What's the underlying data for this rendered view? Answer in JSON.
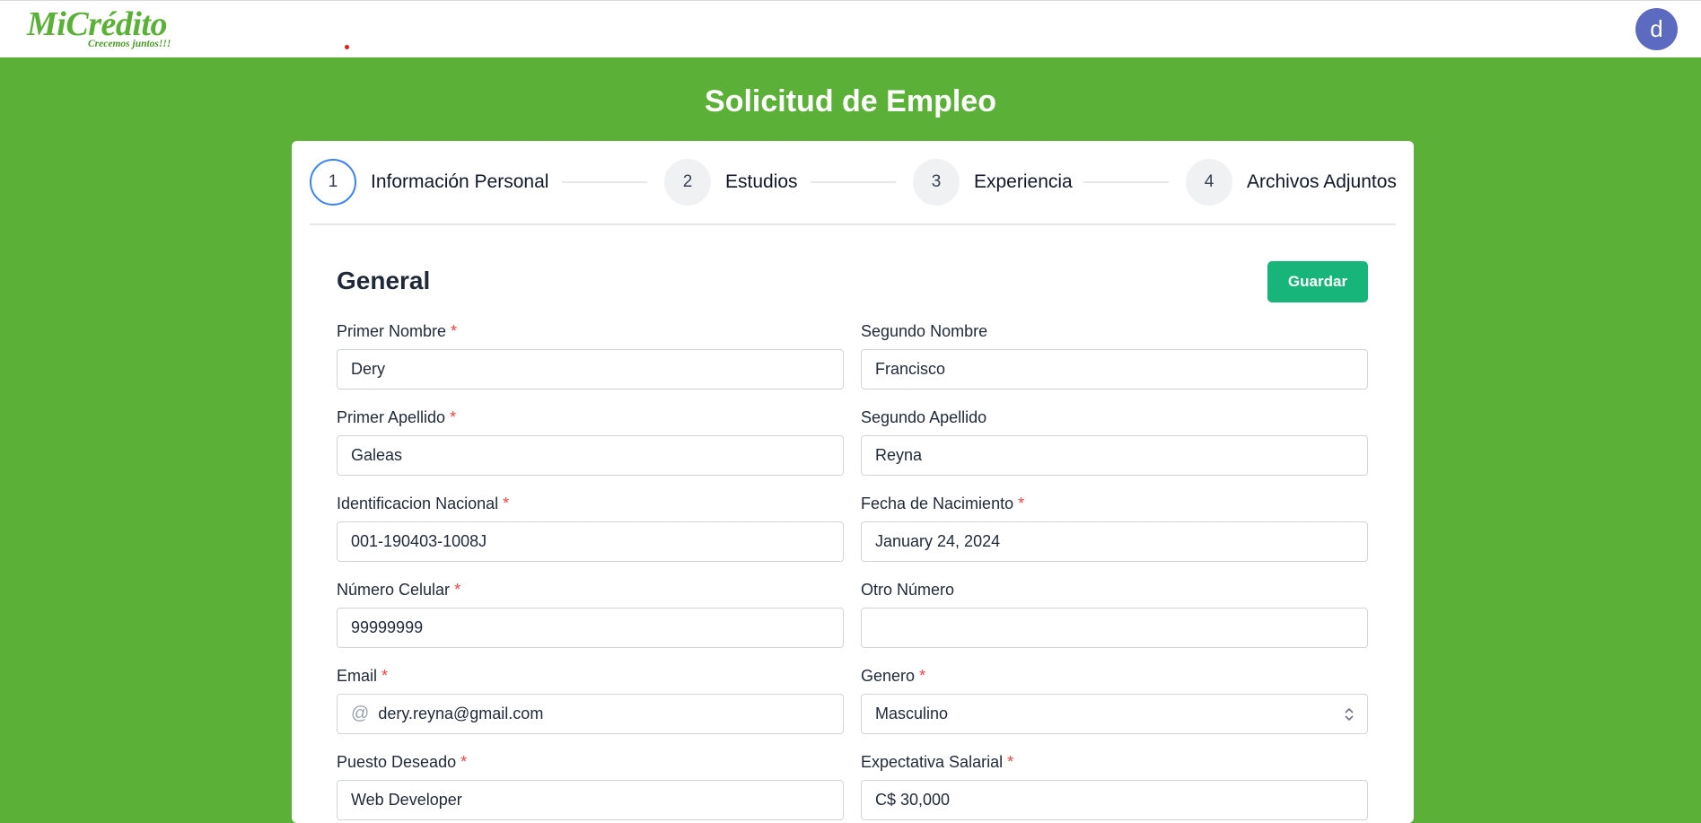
{
  "header": {
    "logo_brand": "MiCrédito",
    "logo_tagline": "Crecemos juntos!!!",
    "avatar_initial": "d"
  },
  "page": {
    "title": "Solicitud de Empleo"
  },
  "steps": [
    {
      "number": "1",
      "label": "Información Personal",
      "active": true
    },
    {
      "number": "2",
      "label": "Estudios",
      "active": false
    },
    {
      "number": "3",
      "label": "Experiencia",
      "active": false
    },
    {
      "number": "4",
      "label": "Archivos Adjuntos",
      "active": false
    }
  ],
  "section": {
    "title": "General",
    "save_label": "Guardar"
  },
  "fields": {
    "primer_nombre": {
      "label": "Primer Nombre",
      "required": true,
      "value": "Dery"
    },
    "segundo_nombre": {
      "label": "Segundo Nombre",
      "required": false,
      "value": "Francisco"
    },
    "primer_apellido": {
      "label": "Primer Apellido",
      "required": true,
      "value": "Galeas"
    },
    "segundo_apellido": {
      "label": "Segundo Apellido",
      "required": false,
      "value": "Reyna"
    },
    "identificacion": {
      "label": "Identificacion Nacional",
      "required": true,
      "value": "001-190403-1008J"
    },
    "fecha_nacimiento": {
      "label": "Fecha de Nacimiento",
      "required": true,
      "value": "January 24, 2024"
    },
    "numero_celular": {
      "label": "Número Celular",
      "required": true,
      "value": "99999999"
    },
    "otro_numero": {
      "label": "Otro Número",
      "required": false,
      "value": ""
    },
    "email": {
      "label": "Email",
      "required": true,
      "value": "dery.reyna@gmail.com",
      "icon": "at-icon"
    },
    "genero": {
      "label": "Genero",
      "required": true,
      "value": "Masculino"
    },
    "puesto_deseado": {
      "label": "Puesto Deseado",
      "required": true,
      "value": "Web Developer"
    },
    "expectativa_salarial": {
      "label": "Expectativa Salarial",
      "required": true,
      "value": "C$ 30,000"
    }
  },
  "required_marker": "*",
  "colors": {
    "page_bg": "#5bb138",
    "accent_button": "#17b57a",
    "active_step_border": "#3b82f6",
    "avatar": "#5c6bc0"
  }
}
